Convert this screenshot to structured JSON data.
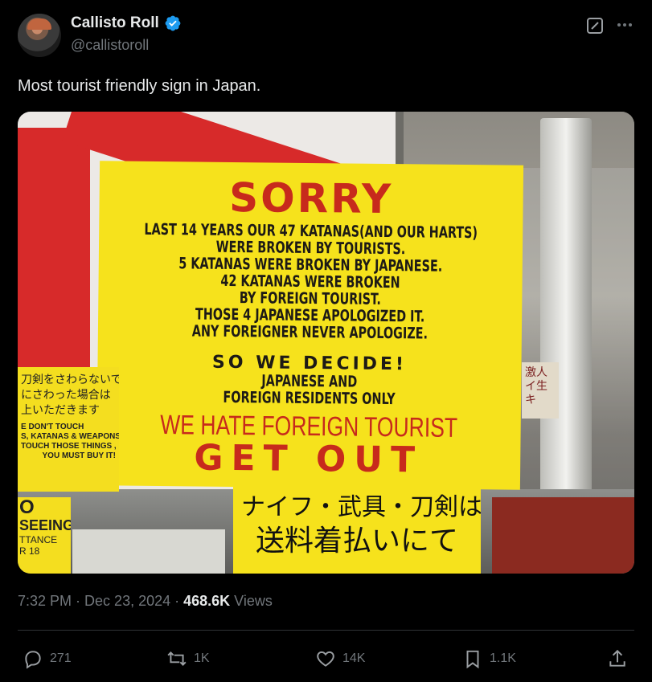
{
  "author": {
    "display_name": "Callisto Roll",
    "handle": "@callistoroll",
    "verified": true,
    "verified_color": "#1d9bf0"
  },
  "tweet": {
    "text": "Most tourist friendly sign in Japan."
  },
  "media": {
    "sign": {
      "heading": "SORRY",
      "lines1": [
        "LAST 14 YEARS OUR 47 KATANAS(AND OUR HARTS)",
        "WERE BROKEN BY TOURISTS.",
        "5 KATANAS WERE BROKEN BY JAPANESE.",
        "42 KATANAS WERE BROKEN",
        "BY FOREIGN TOURIST.",
        "THOSE 4 JAPANESE APOLOGIZED IT.",
        "ANY FOREIGNER NEVER APOLOGIZE."
      ],
      "decide": "SO WE DECIDE!",
      "lines2": [
        "JAPANESE AND",
        "FOREIGN RESIDENTS ONLY"
      ],
      "hate": "WE HATE FOREIGN TOURIST",
      "getout": "GET OUT"
    },
    "left_sign": {
      "jp_lines": [
        "刀剣をさわらないで",
        "にさわった場合は",
        "上いただきます"
      ],
      "en_lines": [
        "E DON'T TOUCH",
        "S, KATANAS & WEAPONS",
        "TOUCH THOSE THINGS ,",
        "YOU MUST BUY IT!"
      ]
    },
    "left_sign2": {
      "lines": [
        "O",
        "SEEING",
        "TTANCE",
        "R 18"
      ]
    },
    "bottom_sign": {
      "line1": "ナイフ・武具・刀剣は",
      "line2": "送料着払いにて"
    },
    "right_sign": {
      "lines": [
        "激人",
        "イ生",
        "キ"
      ]
    }
  },
  "meta": {
    "time": "7:32 PM",
    "separator": "·",
    "date": "Dec 23, 2024",
    "views_count": "468.6K",
    "views_label": "Views"
  },
  "actions": {
    "replies": "271",
    "reposts": "1K",
    "likes": "14K",
    "bookmarks": "1.1K"
  }
}
